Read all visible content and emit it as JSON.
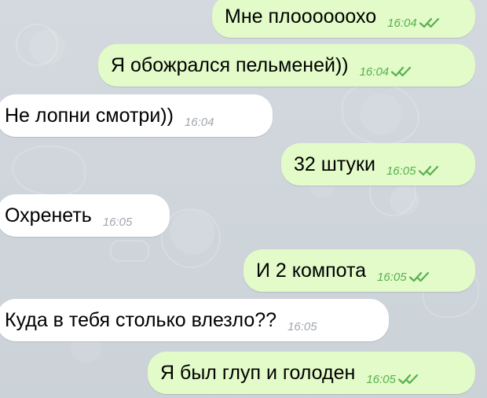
{
  "messages": [
    {
      "text": "Мне плоооооохо",
      "time": "16:04",
      "direction": "out"
    },
    {
      "text": "Я обожрался пельменей))",
      "time": "16:04",
      "direction": "out"
    },
    {
      "text": "Не лопни смотри))",
      "time": "16:04",
      "direction": "in"
    },
    {
      "text": "32 штуки",
      "time": "16:05",
      "direction": "out"
    },
    {
      "text": "Охренеть",
      "time": "16:05",
      "direction": "in"
    },
    {
      "text": "И 2 компота",
      "time": "16:05",
      "direction": "out"
    },
    {
      "text": "Куда в тебя столько влезло??",
      "time": "16:05",
      "direction": "in"
    },
    {
      "text": "Я был глуп и голоден",
      "time": "16:05",
      "direction": "out"
    }
  ],
  "colors": {
    "outgoing_bubble": "#e2fbc9",
    "incoming_bubble": "#ffffff",
    "outgoing_time": "#58b04e",
    "incoming_time": "#a1a7ad",
    "background": "#cfd6dc"
  },
  "icons": {
    "read_receipt": "double-check-icon"
  }
}
